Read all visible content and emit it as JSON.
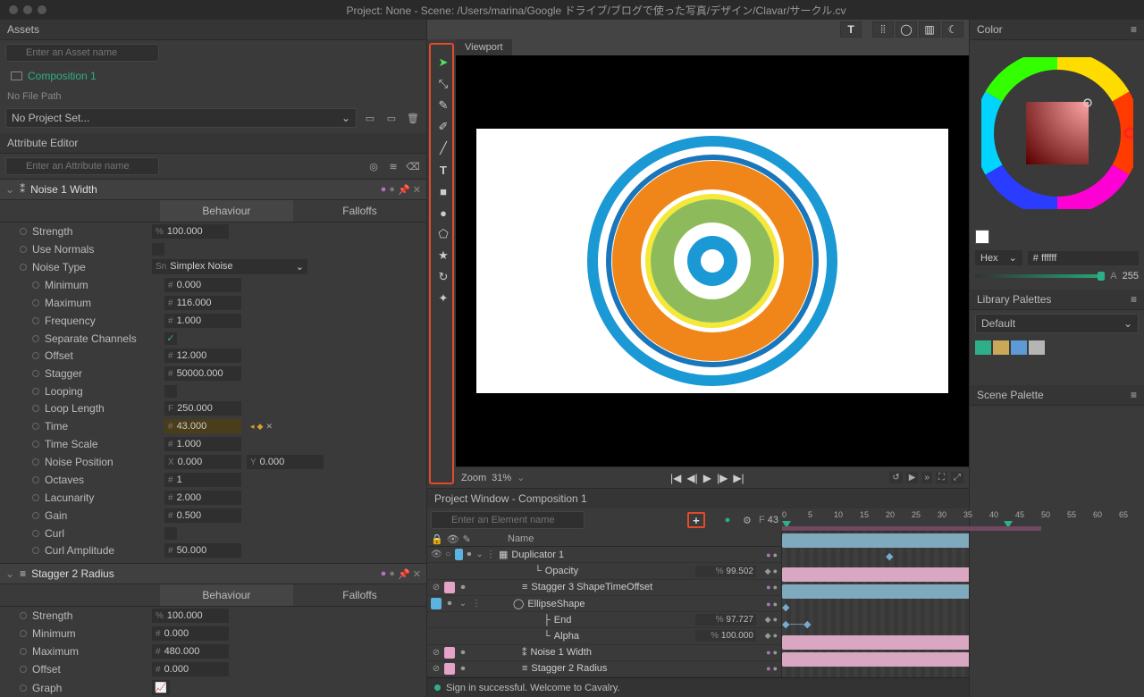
{
  "title": "Project: None - Scene: /Users/marina/Google ドライブ/ブログで使った写真/デザイン/Clavar/サークル.cv",
  "assets": {
    "header": "Assets",
    "search_placeholder": "Enter an Asset name",
    "item": "Composition 1",
    "no_filepath": "No File Path",
    "project_dropdown": "No Project Set..."
  },
  "attrEditor": {
    "header": "Attribute Editor",
    "search_placeholder": "Enter an Attribute name"
  },
  "attr1": {
    "title": "Noise 1 Width",
    "tab_behaviour": "Behaviour",
    "tab_falloffs": "Falloffs",
    "rows": {
      "strength": {
        "label": "Strength",
        "value": "100.000",
        "prefix": "%"
      },
      "useNormals": {
        "label": "Use Normals"
      },
      "noiseType": {
        "label": "Noise Type",
        "value": "Simplex Noise",
        "prefix": "Sn"
      },
      "minimum": {
        "label": "Minimum",
        "value": "0.000",
        "prefix": "#"
      },
      "maximum": {
        "label": "Maximum",
        "value": "116.000",
        "prefix": "#"
      },
      "frequency": {
        "label": "Frequency",
        "value": "1.000",
        "prefix": "#"
      },
      "sepChannels": {
        "label": "Separate Channels"
      },
      "offset": {
        "label": "Offset",
        "value": "12.000",
        "prefix": "#"
      },
      "stagger": {
        "label": "Stagger",
        "value": "50000.000",
        "prefix": "#"
      },
      "looping": {
        "label": "Looping"
      },
      "loopLength": {
        "label": "Loop Length",
        "value": "250.000",
        "prefix": "F"
      },
      "time": {
        "label": "Time",
        "value": "43.000",
        "prefix": "#"
      },
      "timeScale": {
        "label": "Time Scale",
        "value": "1.000",
        "prefix": "#"
      },
      "noisePosX": {
        "label": "Noise Position",
        "value": "0.000",
        "prefix": "X"
      },
      "noisePosY": {
        "value": "0.000",
        "prefix": "Y"
      },
      "octaves": {
        "label": "Octaves",
        "value": "1",
        "prefix": "#"
      },
      "lacunarity": {
        "label": "Lacunarity",
        "value": "2.000",
        "prefix": "#"
      },
      "gain": {
        "label": "Gain",
        "value": "0.500",
        "prefix": "#"
      },
      "curl": {
        "label": "Curl"
      },
      "curlamp": {
        "label": "Curl Amplitude",
        "value": "50.000",
        "prefix": "#"
      }
    }
  },
  "attr2": {
    "title": "Stagger 2 Radius",
    "tab_behaviour": "Behaviour",
    "tab_falloffs": "Falloffs",
    "rows": {
      "strength": {
        "label": "Strength",
        "value": "100.000",
        "prefix": "%"
      },
      "minimum": {
        "label": "Minimum",
        "value": "0.000",
        "prefix": "#"
      },
      "maximum": {
        "label": "Maximum",
        "value": "480.000",
        "prefix": "#"
      },
      "offset": {
        "label": "Offset",
        "value": "0.000",
        "prefix": "#"
      },
      "graph": {
        "label": "Graph"
      }
    }
  },
  "viewport": {
    "tab": "Viewport",
    "zoom_label": "Zoom",
    "zoom_value": "31%"
  },
  "projectWindow": {
    "header": "Project Window - Composition 1",
    "search_placeholder": "Enter an Element name",
    "frame_prefix": "F",
    "frame": "43",
    "col_name": "Name",
    "layers": {
      "dup": "Duplicator 1",
      "opacity": {
        "label": "Opacity",
        "value": "99.502",
        "prefix": "%"
      },
      "stagger3": "Stagger 3 ShapeTimeOffset",
      "ellipse": "EllipseShape",
      "end": {
        "label": "End",
        "value": "97.727",
        "prefix": "%"
      },
      "alpha": {
        "label": "Alpha",
        "value": "100.000",
        "prefix": "%"
      },
      "noise1": "Noise 1 Width",
      "stagger2": "Stagger 2 Radius"
    },
    "ruler_ticks": [
      "0",
      "5",
      "10",
      "15",
      "20",
      "25",
      "30",
      "35",
      "40",
      "45",
      "50",
      "55",
      "60",
      "65"
    ]
  },
  "status": "Sign in successful. Welcome to Cavalry.",
  "color": {
    "header": "Color",
    "format": "Hex",
    "hex": "ffffff",
    "alpha_label": "A",
    "alpha": "255",
    "palettes_header": "Library Palettes",
    "palette_name": "Default",
    "scene_palette": "Scene Palette"
  }
}
